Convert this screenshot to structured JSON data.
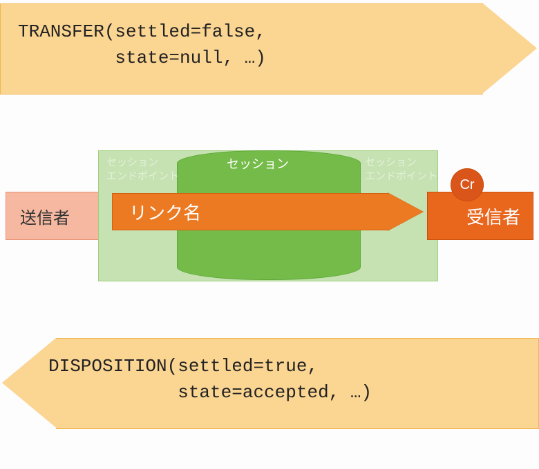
{
  "top_arrow": {
    "text": "TRANSFER(settled=false,\n         state=null, …)"
  },
  "bottom_arrow": {
    "text": "DISPOSITION(settled=true,\n            state=accepted, …)"
  },
  "sender": {
    "label": "送信者"
  },
  "receiver": {
    "label": "受信者"
  },
  "session": {
    "endpoint_left": "セッション\nエンドポイント",
    "title": "セッション",
    "endpoint_right": "セッション\nエンドポイント"
  },
  "link": {
    "label": "リンク名"
  },
  "credit_badge": "Cr",
  "colors": {
    "arrow_bg": "#fbd592",
    "arrow_border": "#f0b550",
    "sender_bg": "#f6b8a0",
    "receiver_bg": "#e9661d",
    "session_outer": "#c6e2b2",
    "session_inner": "#75bb4a",
    "link_bg": "#ec7a23",
    "badge_bg": "#d9551a"
  }
}
